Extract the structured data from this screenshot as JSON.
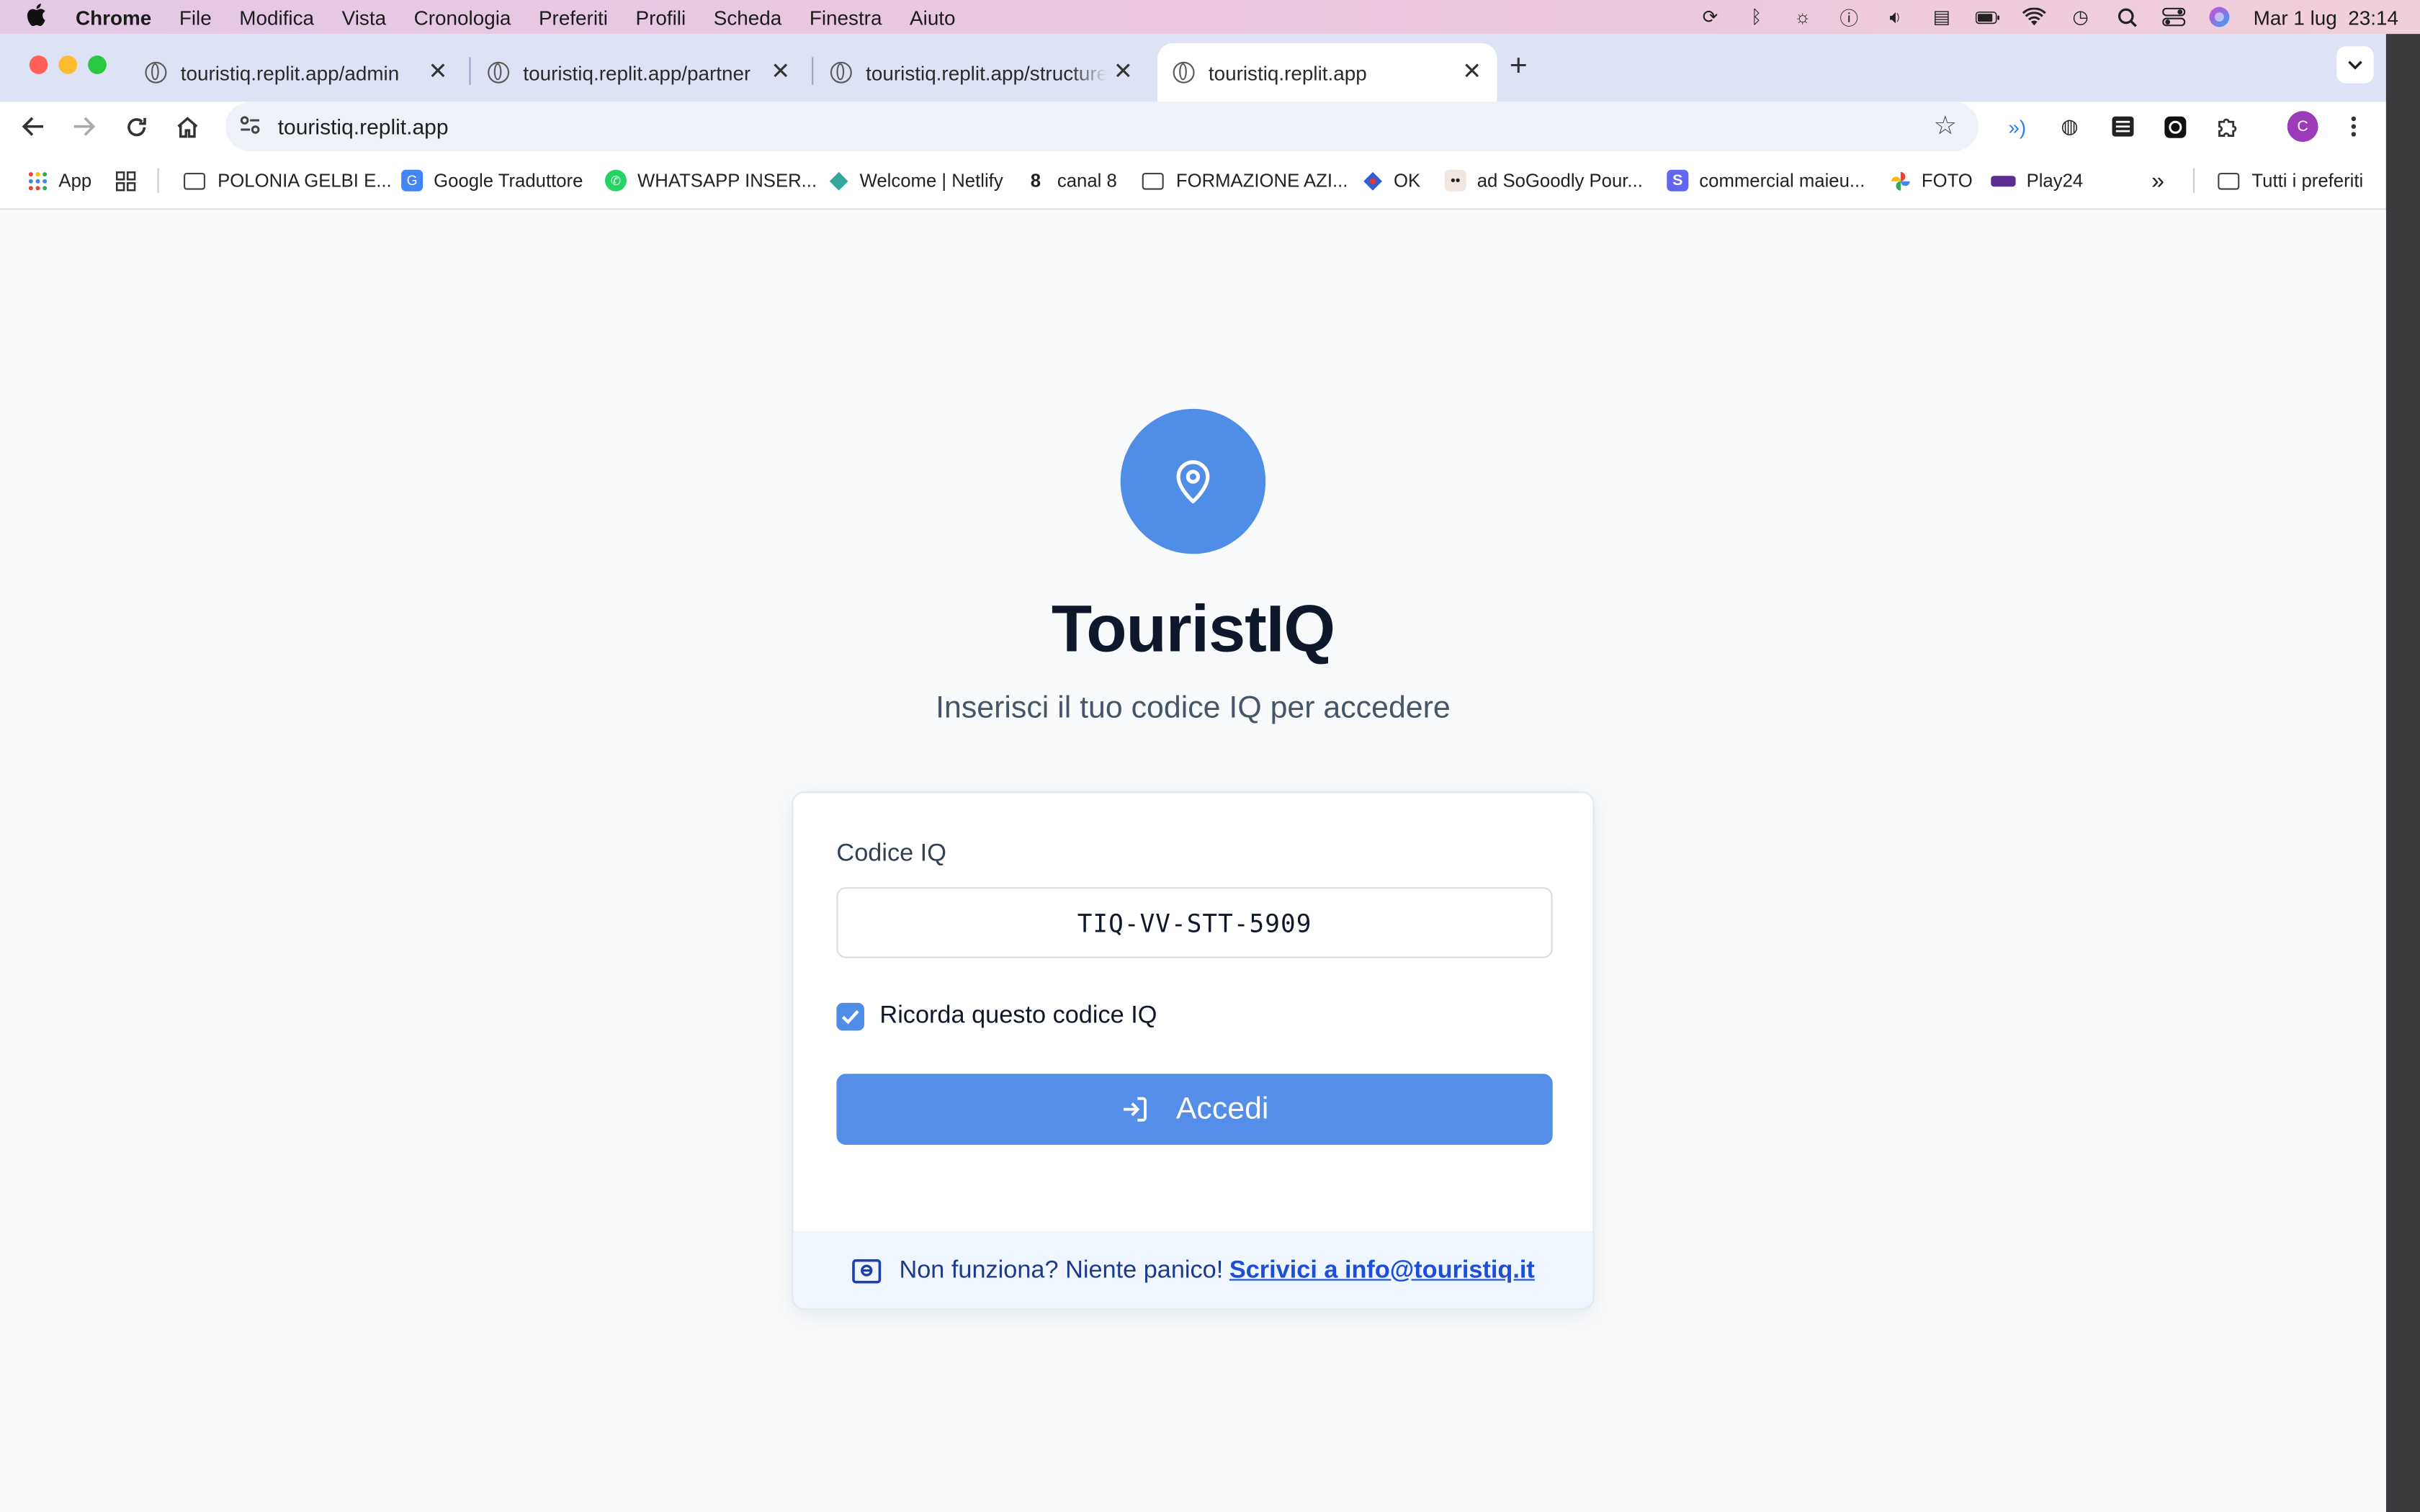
{
  "menubar": {
    "app": "Chrome",
    "items": [
      "File",
      "Modifica",
      "Vista",
      "Cronologia",
      "Preferiti",
      "Profili",
      "Scheda",
      "Finestra",
      "Aiuto"
    ],
    "datetime": "Mar 1 lug  23:14"
  },
  "tabs": [
    {
      "label": "touristiq.replit.app/admin"
    },
    {
      "label": "touristiq.replit.app/partner"
    },
    {
      "label": "touristiq.replit.app/structure/"
    },
    {
      "label": "touristiq.replit.app"
    }
  ],
  "omnibox": {
    "url": "touristiq.replit.app"
  },
  "profile_initial": "C",
  "bookmarks": {
    "items": [
      {
        "label": "App"
      },
      {
        "label": "POLONIA GELBI E..."
      },
      {
        "label": "Google Traduttore"
      },
      {
        "label": "WHATSAPP INSER..."
      },
      {
        "label": "Welcome | Netlify"
      },
      {
        "label": "canal 8"
      },
      {
        "label": "FORMAZIONE AZI..."
      },
      {
        "label": "OK"
      },
      {
        "label": "ad SoGoodly Pour..."
      },
      {
        "label": "commercial maieu..."
      },
      {
        "label": "FOTO"
      },
      {
        "label": "Play24"
      }
    ],
    "overflow": "»",
    "all": "Tutti i preferiti"
  },
  "login": {
    "brand": "TouristIQ",
    "subtitle": "Inserisci il tuo codice IQ per accedere",
    "field_label": "Codice IQ",
    "code_value": "TIQ-VV-STT-5909",
    "remember_label": "Ricorda questo codice IQ",
    "remember_checked": true,
    "submit_label": "Accedi",
    "help_text": "Non funziona? Niente panico!",
    "help_link": "Scrivici a info@touristiq.it"
  },
  "colors": {
    "accent": "#4f8de6",
    "button": "#558ee9",
    "help_bg": "#eff6ff",
    "link": "#1d4ed8"
  }
}
